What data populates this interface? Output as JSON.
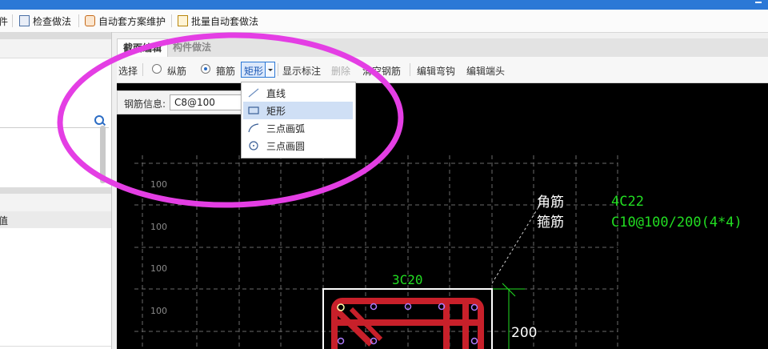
{
  "colors": {
    "titlebar": "#2b78d6",
    "highlight": "#e43ee4",
    "rebar": "#c8202a",
    "label_green": "#22dd22",
    "grid_dash": "#6a6a6a",
    "canvas_bg": "#000000"
  },
  "top_toolbar": {
    "partial_label": "件",
    "items": [
      {
        "label": "检查做法",
        "icon": "check-doc-icon"
      },
      {
        "label": "自动套方案维护",
        "icon": "gear-doc-icon"
      },
      {
        "label": "批量自动套做法",
        "icon": "batch-icon"
      }
    ]
  },
  "left_panel": {
    "column_header_partial": "值"
  },
  "section_tabs": [
    {
      "label": "截面编辑",
      "active": true
    },
    {
      "label": "构件做法",
      "active": false
    }
  ],
  "edit_toolbar": {
    "select": "选择",
    "longitudinal": "纵筋",
    "stirrup": "箍筋",
    "shape_combo": "矩形",
    "show_annotation": "显示标注",
    "delete": "删除",
    "clear_rebar": "清空钢筋",
    "edit_hook": "编辑弯钩",
    "edit_end": "编辑端头"
  },
  "rebar_info": {
    "label": "钢筋信息:",
    "value": "C8@100"
  },
  "shape_dropdown": {
    "items": [
      {
        "label": "直线",
        "icon": "line-icon",
        "selected": false
      },
      {
        "label": "矩形",
        "icon": "rectangle-icon",
        "selected": true
      },
      {
        "label": "三点画弧",
        "icon": "arc-icon",
        "selected": false
      },
      {
        "label": "三点画圆",
        "icon": "circle-icon",
        "selected": false
      }
    ]
  },
  "drawing": {
    "grid_labels": [
      "100",
      "100",
      "100",
      "100"
    ],
    "corner_label": "角筋",
    "corner_value": "4C22",
    "stirrup_label": "箍筋",
    "stirrup_value": "C10@100/200(4*4)",
    "top_rebar": "3C20",
    "dimension": "200"
  }
}
